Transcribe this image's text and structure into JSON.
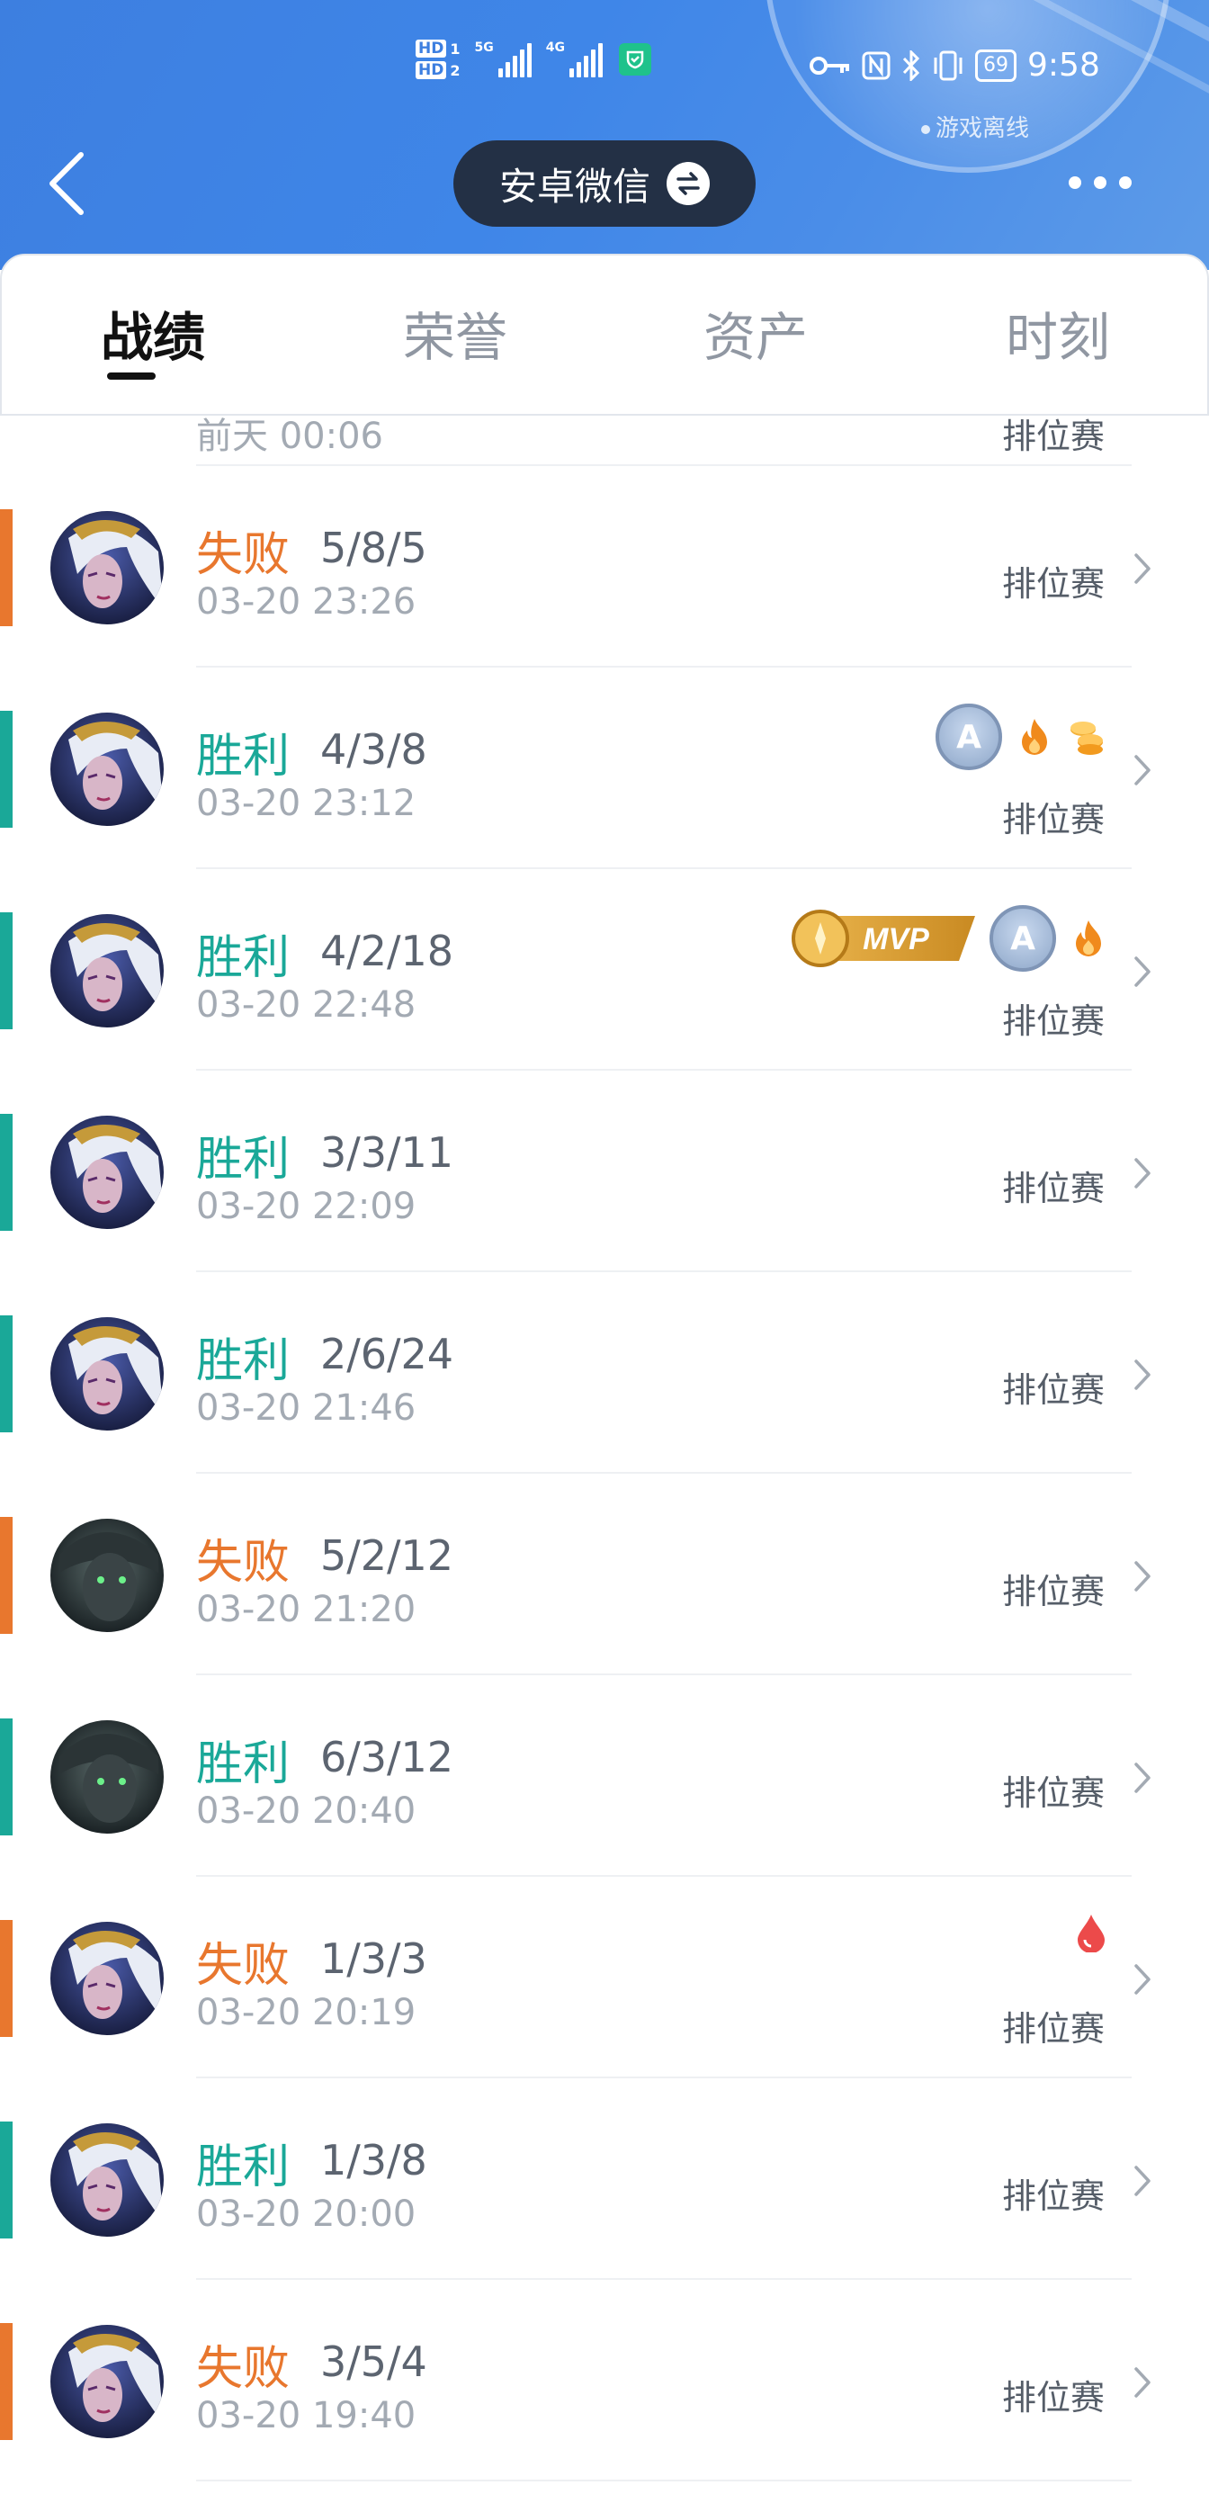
{
  "status_bar": {
    "network": [
      "HD",
      "HD",
      "5G",
      "4G"
    ],
    "sim_labels": [
      "1",
      "2"
    ],
    "battery": "69",
    "time": "9:58",
    "icons": [
      "vpn-key-icon",
      "nfc-icon",
      "bluetooth-icon",
      "vibrate-icon",
      "battery-icon"
    ]
  },
  "game_status": "游戏离线",
  "header": {
    "title": "安卓微信",
    "back_icon": "chevron-left-icon",
    "switch_icon": "swap-icon",
    "more_icon": "more-icon"
  },
  "tabs": [
    {
      "label": "战绩",
      "active": true
    },
    {
      "label": "荣誉",
      "active": false
    },
    {
      "label": "资产",
      "active": false
    },
    {
      "label": "时刻",
      "active": false
    }
  ],
  "partial_row": {
    "time": "前天 00:06",
    "mode": "排位赛"
  },
  "matches": [
    {
      "result": "失败",
      "kda": "5/8/5",
      "time": "03-20 23:26",
      "mode": "排位赛",
      "win": false,
      "hero": "white-hair",
      "badges": []
    },
    {
      "result": "胜利",
      "kda": "4/3/8",
      "time": "03-20 23:12",
      "mode": "排位赛",
      "win": true,
      "hero": "white-hair",
      "badges": [
        "grade-a-badge",
        "fire-icon",
        "coins-icon"
      ]
    },
    {
      "result": "胜利",
      "kda": "4/2/18",
      "time": "03-20 22:48",
      "mode": "排位赛",
      "win": true,
      "hero": "white-hair",
      "badges": [
        "mvp-badge",
        "grade-a-badge",
        "fire-icon"
      ]
    },
    {
      "result": "胜利",
      "kda": "3/3/11",
      "time": "03-20 22:09",
      "mode": "排位赛",
      "win": true,
      "hero": "white-hair",
      "badges": []
    },
    {
      "result": "胜利",
      "kda": "2/6/24",
      "time": "03-20 21:46",
      "mode": "排位赛",
      "win": true,
      "hero": "white-hair",
      "badges": []
    },
    {
      "result": "失败",
      "kda": "5/2/12",
      "time": "03-20 21:20",
      "mode": "排位赛",
      "win": false,
      "hero": "dark",
      "badges": []
    },
    {
      "result": "胜利",
      "kda": "6/3/12",
      "time": "03-20 20:40",
      "mode": "排位赛",
      "win": true,
      "hero": "dark",
      "badges": []
    },
    {
      "result": "失败",
      "kda": "1/3/3",
      "time": "03-20 20:19",
      "mode": "排位赛",
      "win": false,
      "hero": "white-hair",
      "badges": [
        "blood-drop-icon"
      ]
    },
    {
      "result": "胜利",
      "kda": "1/3/8",
      "time": "03-20 20:00",
      "mode": "排位赛",
      "win": true,
      "hero": "white-hair",
      "badges": []
    },
    {
      "result": "失败",
      "kda": "3/5/4",
      "time": "03-20 19:40",
      "mode": "排位赛",
      "win": false,
      "hero": "white-hair",
      "badges": []
    }
  ],
  "badge_text": {
    "grade": "A",
    "mvp": "MVP"
  },
  "colors": {
    "win": "#1aa898",
    "loss": "#e8772e",
    "header": "#3f86e8",
    "pill": "#233045"
  }
}
